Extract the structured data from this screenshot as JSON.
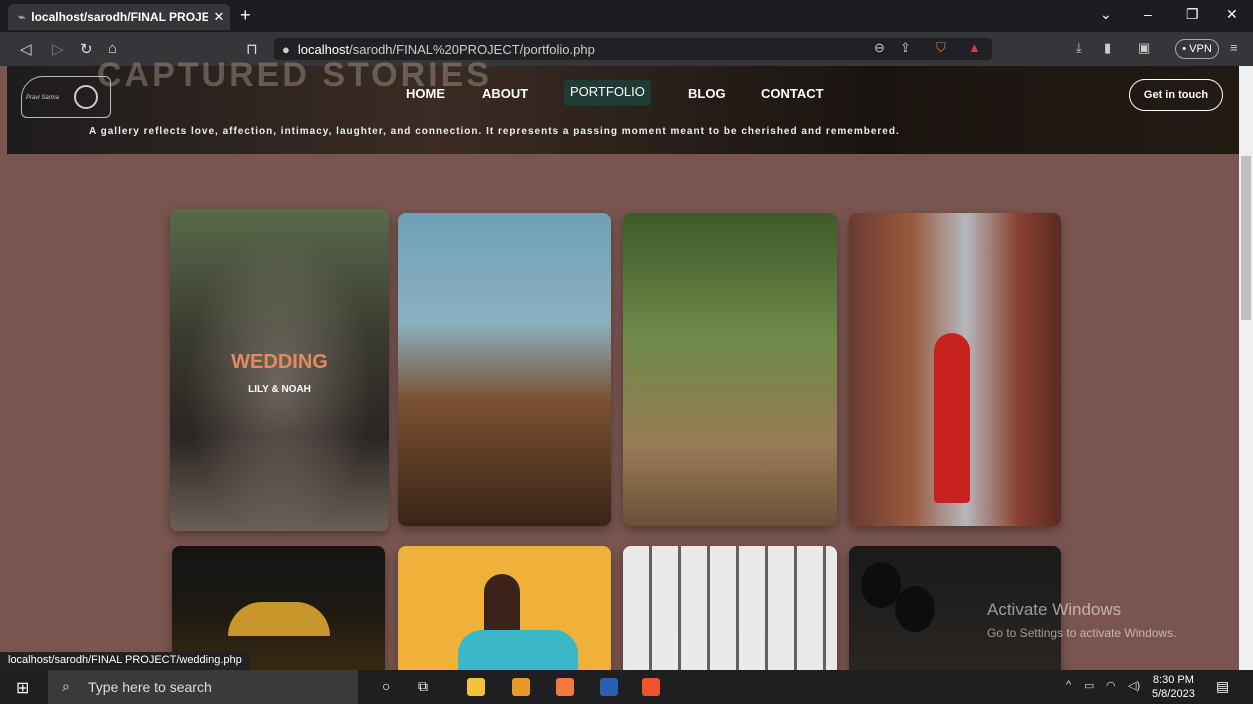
{
  "browser": {
    "tab_title": "localhost/sarodh/FINAL PROJECT",
    "url_host": "localhost",
    "url_path": "/sarodh/FINAL%20PROJECT/portfolio.php",
    "vpn_label": "• VPN"
  },
  "header": {
    "banner_title": "CAPTURED STORIES",
    "logo_text": "Pravi Sarma",
    "nav": [
      "HOME",
      "ABOUT",
      "PORTFOLIO",
      "BLOG",
      "CONTACT"
    ],
    "cta": "Get in touch",
    "tagline": "A gallery reflects love, affection, intimacy, laughter, and connection. It represents a passing moment meant to be cherished and remembered."
  },
  "gallery": {
    "featured_title": "WEDDING",
    "featured_subtitle": "LILY & NOAH"
  },
  "status_url": "localhost/sarodh/FINAL PROJECT/wedding.php",
  "watermark": {
    "line1": "Activate Windows",
    "line2": "Go to Settings to activate Windows."
  },
  "taskbar": {
    "search_placeholder": "Type here to search",
    "time": "8:30 PM",
    "date": "5/8/2023"
  },
  "colors": {
    "page_bg": "#7a5550",
    "accent_text": "#e58a5c",
    "nav_active_bg": "#1e3b35"
  }
}
